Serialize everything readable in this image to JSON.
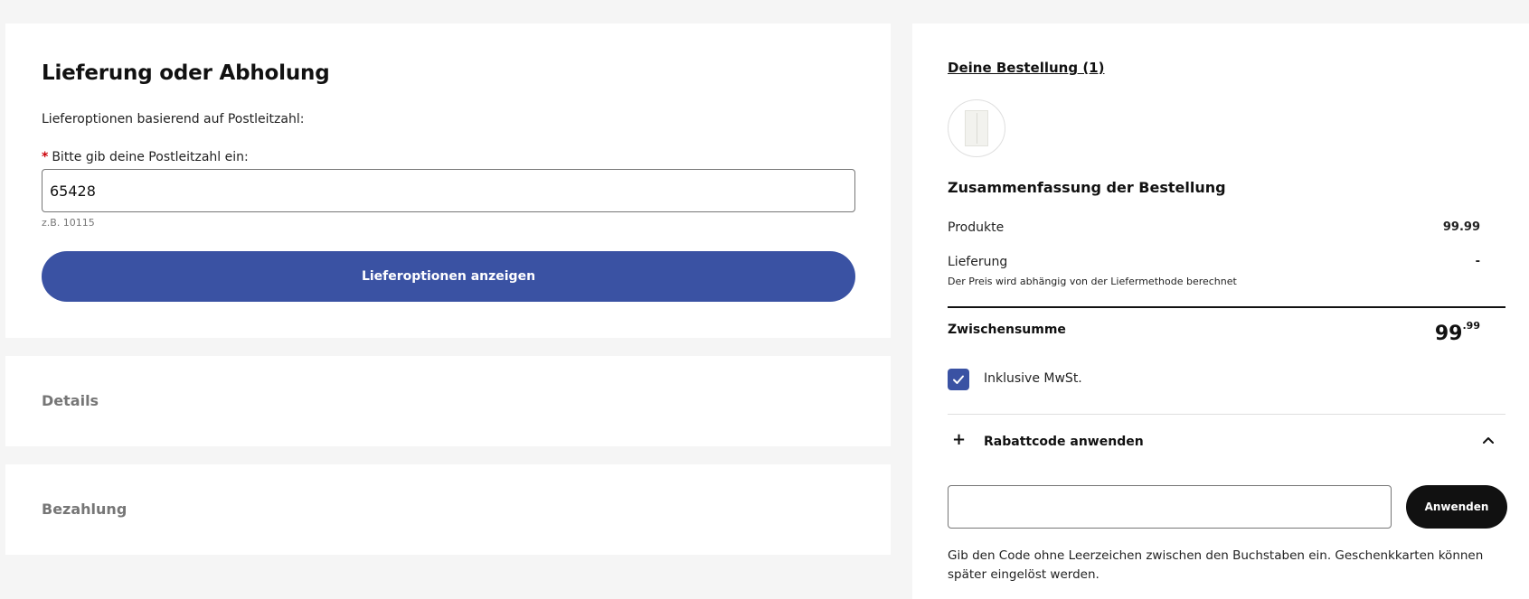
{
  "delivery": {
    "title": "Lieferung oder Abholung",
    "subtitle": "Lieferoptionen basierend auf Postleitzahl:",
    "required_marker": "*",
    "zip_label": "Bitte gib deine Postleitzahl ein:",
    "zip_value": "65428",
    "zip_hint": "z.B. 10115",
    "show_options_button": "Lieferoptionen anzeigen"
  },
  "sections": {
    "details": "Details",
    "payment": "Bezahlung"
  },
  "summary": {
    "order_link": "Deine Bestellung (1)",
    "title": "Zusammenfassung der Bestellung",
    "products_label": "Produkte",
    "products_value": "99.99",
    "delivery_label": "Lieferung",
    "delivery_value": "-",
    "delivery_note": "Der Preis wird abhängig von der Liefermethode berechnet",
    "subtotal_label": "Zwischensumme",
    "subtotal_int": "99",
    "subtotal_dec": ".99",
    "vat_label": "Inklusive MwSt.",
    "vat_checked": true,
    "discount_label": "Rabattcode anwenden",
    "discount_input_value": "",
    "apply_button": "Anwenden",
    "code_help": "Gib den Code ohne Leerzeichen zwischen den Buchstaben ein. Geschenkkarten können später eingelöst werden."
  },
  "icons": {
    "checkmark": "check-icon",
    "plus": "plus-icon",
    "chevron": "chevron-up-icon",
    "product": "wardrobe-thumbnail"
  },
  "colors": {
    "primary_blue": "#3a52a3",
    "required_red": "#cc0008",
    "dark_button": "#111111",
    "page_bg": "#f5f5f5"
  }
}
